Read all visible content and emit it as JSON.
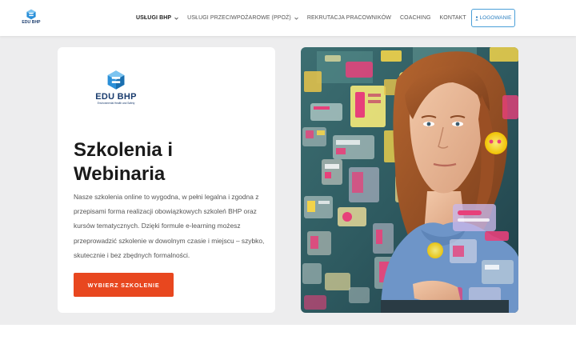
{
  "header": {
    "logo": {
      "text": "EDU BHP"
    },
    "nav": [
      {
        "label": "USŁUGI BHP",
        "dropdown": true,
        "active": true
      },
      {
        "label": "USŁUGI PRZECIWPOŻAROWE (PPOŻ)",
        "dropdown": true,
        "active": false
      },
      {
        "label": "REKRUTACJA PRACOWNIKÓW",
        "dropdown": false,
        "active": false
      },
      {
        "label": "COACHING",
        "dropdown": false,
        "active": false
      },
      {
        "label": "KONTAKT",
        "dropdown": false,
        "active": false
      }
    ],
    "login_label": "LOGOWANIE",
    "login_icon": "user-icon"
  },
  "hero": {
    "logo_title": "EDU BHP",
    "logo_subtitle": "Environmental Health and Safety",
    "headline": "Szkolenia i Webinaria",
    "description": "Nasze szkolenia online to wygodna, w pełni legalna i zgodna z przepisami forma realizacji obowiązkowych szkoleń BHP oraz kursów tematycznych. Dzięki formule e-learning możesz przeprowadzić szkolenie w dowolnym czasie i miejscu – szybko, skutecznie i bez zbędnych formalności.",
    "cta_label": "WYBIERZ SZKOLENIE"
  },
  "colors": {
    "accent": "#e8471f",
    "brand": "#1a3c6e",
    "brand_light": "#2a8fd8",
    "login_border": "#4a9fd8",
    "band_bg": "#ededee"
  }
}
